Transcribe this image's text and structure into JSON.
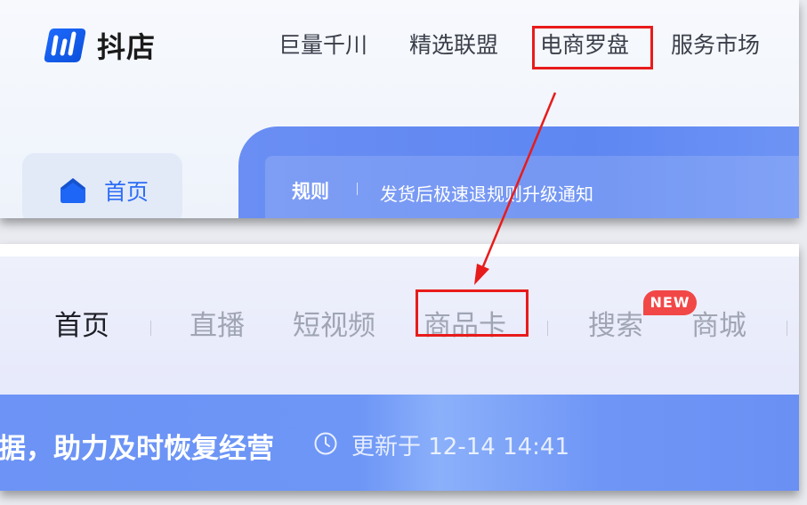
{
  "brand": {
    "name": "抖店"
  },
  "top_nav": {
    "items": [
      "巨量千川",
      "精选联盟",
      "电商罗盘",
      "服务市场"
    ]
  },
  "sidebar": {
    "home_label": "首页"
  },
  "notice": {
    "tag": "规则",
    "text": "发货后极速退规则升级通知"
  },
  "tabs": {
    "items": [
      "首页",
      "直播",
      "短视频",
      "商品卡",
      "搜索",
      "商城"
    ],
    "new_badge": "NEW"
  },
  "data_banner": {
    "title": "数据，助力及时恢复经营",
    "update_label": "更新于 12-14 14:41"
  },
  "colors": {
    "brand_blue": "#2c6cf5",
    "highlight_red": "#e81b1b",
    "badge_red": "#f24747",
    "banner_blue": "#6a8ef3"
  }
}
